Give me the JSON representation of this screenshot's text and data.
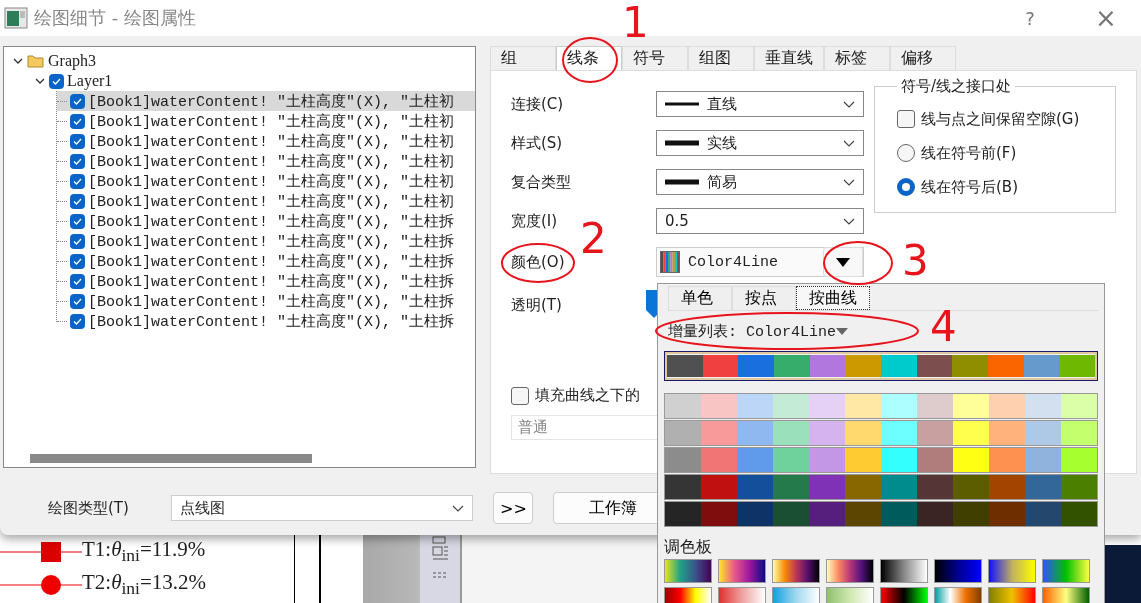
{
  "window": {
    "title": "绘图细节 - 绘图属性",
    "help": "?",
    "close": "×"
  },
  "tree": {
    "label": "Graph3",
    "expanded": true,
    "children": [
      {
        "label": "Layer1",
        "expanded": true,
        "checked": true,
        "children": [
          {
            "label": "[Book1]waterContent! \"土柱高度\"(X), \"土柱初",
            "checked": true,
            "selected": true
          },
          {
            "label": "[Book1]waterContent! \"土柱高度\"(X), \"土柱初",
            "checked": true,
            "selected": false
          },
          {
            "label": "[Book1]waterContent! \"土柱高度\"(X), \"土柱初",
            "checked": true,
            "selected": false
          },
          {
            "label": "[Book1]waterContent! \"土柱高度\"(X), \"土柱初",
            "checked": true,
            "selected": false
          },
          {
            "label": "[Book1]waterContent! \"土柱高度\"(X), \"土柱初",
            "checked": true,
            "selected": false
          },
          {
            "label": "[Book1]waterContent! \"土柱高度\"(X), \"土柱初",
            "checked": true,
            "selected": false
          },
          {
            "label": "[Book1]waterContent! \"土柱高度\"(X), \"土柱拆",
            "checked": true,
            "selected": false
          },
          {
            "label": "[Book1]waterContent! \"土柱高度\"(X), \"土柱拆",
            "checked": true,
            "selected": false
          },
          {
            "label": "[Book1]waterContent! \"土柱高度\"(X), \"土柱拆",
            "checked": true,
            "selected": false
          },
          {
            "label": "[Book1]waterContent! \"土柱高度\"(X), \"土柱拆",
            "checked": true,
            "selected": false
          },
          {
            "label": "[Book1]waterContent! \"土柱高度\"(X), \"土柱拆",
            "checked": true,
            "selected": false
          },
          {
            "label": "[Book1]waterContent! \"土柱高度\"(X), \"土柱拆",
            "checked": true,
            "selected": false
          }
        ]
      }
    ]
  },
  "tabs": [
    {
      "label": "组",
      "selected": false
    },
    {
      "label": "线条",
      "selected": true
    },
    {
      "label": "符号",
      "selected": false
    },
    {
      "label": "组图",
      "selected": false
    },
    {
      "label": "垂直线",
      "selected": false
    },
    {
      "label": "标签",
      "selected": false
    },
    {
      "label": "偏移",
      "selected": false
    }
  ],
  "form": [
    {
      "kind": "dropdown",
      "label": "连接(C)",
      "value": "直线",
      "line_icon": true,
      "bold_line": false
    },
    {
      "kind": "dropdown",
      "label": "样式(S)",
      "value": "实线",
      "line_icon": true,
      "bold_line": true
    },
    {
      "kind": "dropdown",
      "label": "复合类型",
      "value": "简易",
      "line_icon": true,
      "bold_line": true
    },
    {
      "kind": "dropdown",
      "label": "宽度(I)",
      "value": "0.5"
    },
    {
      "kind": "color",
      "label": "颜色(O)",
      "value": "Color4Line"
    },
    {
      "kind": "slider",
      "label": "透明(T)",
      "level": 0
    }
  ],
  "junction": {
    "title": "符号/线之接口处",
    "options": [
      {
        "kind": "checkbox",
        "label": "线与点之间保留空隙(G)",
        "checked": false
      },
      {
        "kind": "radio",
        "label": "线在符号前(F)",
        "selected": false
      },
      {
        "kind": "radio",
        "label": "线在符号后(B)",
        "selected": true
      }
    ]
  },
  "fill": {
    "label": "填充曲线之下的",
    "checked": false,
    "mode": "普通"
  },
  "bottom": {
    "plot_type_label": "绘图类型(T)",
    "plot_type": "点线图",
    "more_button": ">>",
    "workbook_button": "工作簿"
  },
  "color_popup": {
    "tabs": [
      {
        "label": "单色",
        "selected": false
      },
      {
        "label": "按点",
        "selected": false
      },
      {
        "label": "按曲线",
        "selected": true
      }
    ],
    "increment_label": "增量列表: Color4Line",
    "swatch_rows": [
      {
        "selected": true,
        "swatches": [
          {
            "color": "#505050"
          },
          {
            "color": "#f04040"
          },
          {
            "color": "#1a6fdf"
          },
          {
            "color": "#37ad6b"
          },
          {
            "color": "#b177de"
          },
          {
            "color": "#cc9900"
          },
          {
            "color": "#00cbcc"
          },
          {
            "color": "#7d4e4e"
          },
          {
            "color": "#8e8e00"
          },
          {
            "color": "#fb6500"
          },
          {
            "color": "#6699cc"
          },
          {
            "color": "#6fb802"
          }
        ]
      },
      {
        "selected": false,
        "swatches": [
          {
            "color": "#d0d0d0"
          },
          {
            "color": "#f9c4c4"
          },
          {
            "color": "#bcd6f7"
          },
          {
            "color": "#c3ebd5"
          },
          {
            "color": "#e4d1f5"
          },
          {
            "color": "#ffe8a6"
          },
          {
            "color": "#adffff"
          },
          {
            "color": "#decbcb"
          },
          {
            "color": "#ffff99"
          },
          {
            "color": "#ffd0b0"
          },
          {
            "color": "#d2e0f0"
          },
          {
            "color": "#daffa8"
          }
        ]
      },
      {
        "selected": false,
        "swatches": [
          {
            "color": "#b0b0b0"
          },
          {
            "color": "#f89a9a"
          },
          {
            "color": "#8fb8f0"
          },
          {
            "color": "#9ae0bb"
          },
          {
            "color": "#d4b3ee"
          },
          {
            "color": "#ffd86e"
          },
          {
            "color": "#6dffff"
          },
          {
            "color": "#c8a0a0"
          },
          {
            "color": "#ffff4d"
          },
          {
            "color": "#ffb27c"
          },
          {
            "color": "#adc9e6"
          },
          {
            "color": "#c4ff6e"
          }
        ]
      },
      {
        "selected": false,
        "swatches": [
          {
            "color": "#8c8c8c"
          },
          {
            "color": "#f27575"
          },
          {
            "color": "#5f9bea"
          },
          {
            "color": "#6fd19b"
          },
          {
            "color": "#c496e6"
          },
          {
            "color": "#ffcb33"
          },
          {
            "color": "#33ffff"
          },
          {
            "color": "#b07c7c"
          },
          {
            "color": "#ffff14"
          },
          {
            "color": "#ff9150"
          },
          {
            "color": "#8fb3dc"
          },
          {
            "color": "#a6ff2e"
          }
        ]
      },
      {
        "selected": false,
        "swatches": [
          {
            "color": "#353535"
          },
          {
            "color": "#c01010"
          },
          {
            "color": "#134f9a"
          },
          {
            "color": "#257a4b"
          },
          {
            "color": "#7f32b5"
          },
          {
            "color": "#886600"
          },
          {
            "color": "#008c8c"
          },
          {
            "color": "#553535"
          },
          {
            "color": "#5c5c00"
          },
          {
            "color": "#a34400"
          },
          {
            "color": "#336699"
          },
          {
            "color": "#4b7f00"
          }
        ]
      },
      {
        "selected": false,
        "swatches": [
          {
            "color": "#252525"
          },
          {
            "color": "#800d0d"
          },
          {
            "color": "#0e3366"
          },
          {
            "color": "#1a4f33"
          },
          {
            "color": "#561f7e"
          },
          {
            "color": "#5c4500"
          },
          {
            "color": "#005c5c"
          },
          {
            "color": "#3a2424"
          },
          {
            "color": "#403f00"
          },
          {
            "color": "#6e2e00"
          },
          {
            "color": "#24476d"
          },
          {
            "color": "#335200"
          }
        ]
      }
    ],
    "palette_label": "调色板"
  },
  "legend": [
    {
      "text": "T1:*θ*$_{ini}$=11.9%",
      "kind": "square",
      "color": "#dd0000"
    },
    {
      "text": "T2:*θ*$_{ini}$=13.2%",
      "kind": "circle",
      "color": "#ee0000"
    }
  ],
  "annotations": [
    {
      "text": "1"
    },
    {
      "text": "2"
    },
    {
      "text": "3"
    },
    {
      "text": "4"
    }
  ]
}
